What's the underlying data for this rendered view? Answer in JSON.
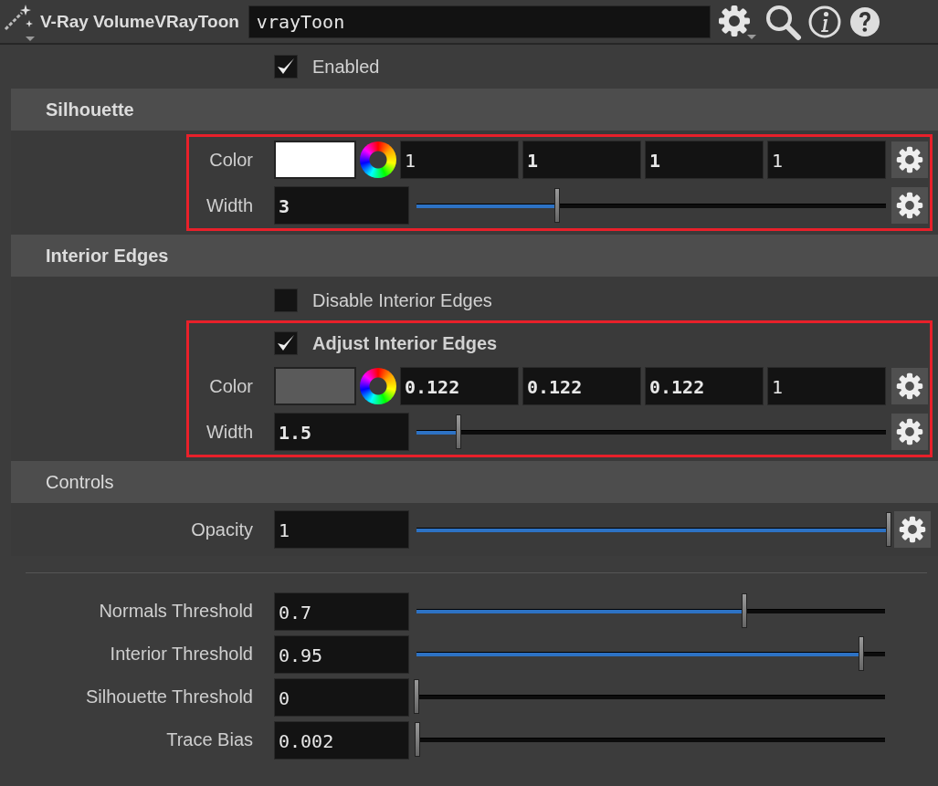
{
  "header": {
    "title": "V-Ray VolumeVRayToon",
    "node_name": "vrayToon"
  },
  "enabled": {
    "label": "Enabled",
    "checked": true
  },
  "sections": [
    {
      "title": "Silhouette",
      "title_bold": true,
      "groups": [
        {
          "highlighted": true,
          "rows": [
            {
              "kind": "color",
              "label": "Color",
              "color": "#ffffff",
              "values": [
                {
                  "text": "1",
                  "modified": false
                },
                {
                  "text": "1",
                  "modified": true
                },
                {
                  "text": "1",
                  "modified": true
                },
                {
                  "text": "1",
                  "modified": false
                }
              ]
            },
            {
              "kind": "slider",
              "label": "Width",
              "value": "3",
              "modified": true,
              "level": 0.3
            }
          ]
        }
      ]
    },
    {
      "title": "Interior Edges",
      "title_bold": true,
      "groups": [
        {
          "highlighted": false,
          "rows": [
            {
              "kind": "checkbox",
              "label": "Disable Interior Edges",
              "checked": false,
              "modified": false
            }
          ]
        },
        {
          "highlighted": true,
          "rows": [
            {
              "kind": "checkbox",
              "label": "Adjust Interior Edges",
              "checked": true,
              "modified": true
            },
            {
              "kind": "color",
              "label": "Color",
              "color": "#5a5a5a",
              "values": [
                {
                  "text": "0.122",
                  "modified": true
                },
                {
                  "text": "0.122",
                  "modified": true
                },
                {
                  "text": "0.122",
                  "modified": true
                },
                {
                  "text": "1",
                  "modified": false
                }
              ]
            },
            {
              "kind": "slider",
              "label": "Width",
              "value": "1.5",
              "modified": true,
              "level": 0.09
            }
          ]
        }
      ]
    },
    {
      "title": "Controls",
      "title_bold": false,
      "groups": [
        {
          "highlighted": false,
          "rows": [
            {
              "kind": "slider",
              "label": "Opacity",
              "value": "1",
              "modified": false,
              "level": 1
            }
          ]
        }
      ]
    }
  ],
  "parameters": [
    {
      "label": "Normals Threshold",
      "value": "0.7",
      "level": 0.7
    },
    {
      "label": "Interior Threshold",
      "value": "0.95",
      "level": 0.95
    },
    {
      "label": "Silhouette Threshold",
      "value": "0",
      "level": 0
    },
    {
      "label": "Trace Bias",
      "value": "0.002",
      "level": 0.002
    }
  ]
}
